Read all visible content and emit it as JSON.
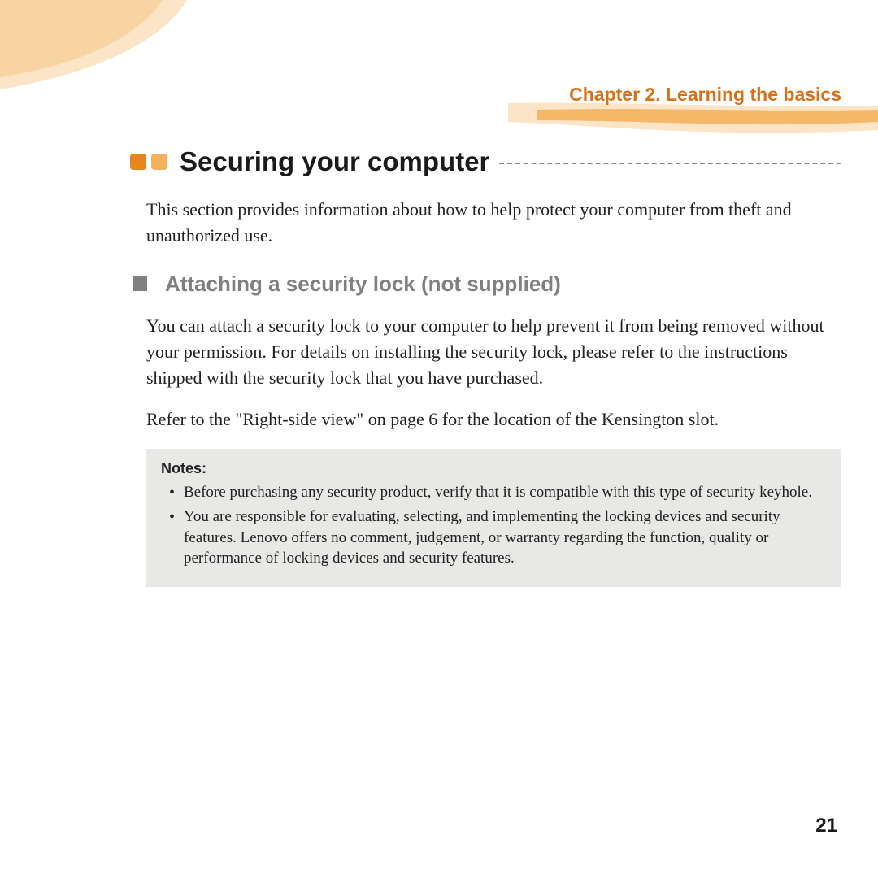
{
  "header": {
    "chapter": "Chapter 2. Learning the basics"
  },
  "section": {
    "title": "Securing your computer",
    "intro": "This section provides information about how to help protect your computer from theft and unauthorized use."
  },
  "subsection": {
    "title": "Attaching a security lock (not supplied)",
    "paragraphs": [
      "You can attach a security lock to your computer to help prevent it from being removed without your permission. For details on installing the security lock, please refer to the instructions shipped with the security lock that you have purchased.",
      "Refer to the \"Right-side view\" on page 6 for the location of the Kensington slot."
    ]
  },
  "notes": {
    "label": "Notes:",
    "items": [
      "Before purchasing any security product, verify that it is compatible with this type of security keyhole.",
      "You are responsible for evaluating, selecting, and implementing the locking devices and security features. Lenovo offers no comment, judgement, or warranty regarding the function, quality or performance of locking devices and security features."
    ]
  },
  "page_number": "21"
}
